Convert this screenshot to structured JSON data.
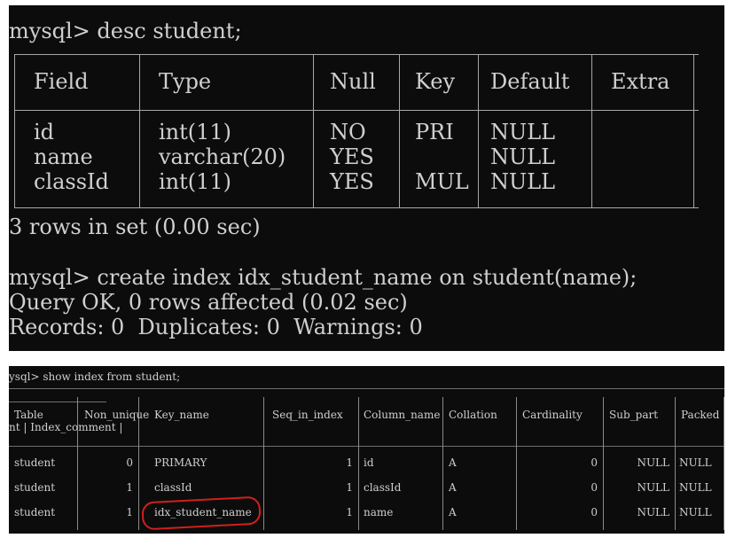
{
  "terminal1": {
    "prompt_cmd": "mysql> desc student;",
    "columns": [
      "Field",
      "Type",
      "Null",
      "Key",
      "Default",
      "Extra"
    ],
    "rows": [
      [
        "id",
        "int(11)",
        "NO",
        "PRI",
        "NULL",
        ""
      ],
      [
        "name",
        "varchar(20)",
        "YES",
        "",
        "NULL",
        ""
      ],
      [
        "classId",
        "int(11)",
        "YES",
        "MUL",
        "NULL",
        ""
      ]
    ],
    "summary": "3 rows in set (0.00 sec)",
    "create_cmd": "mysql> create index idx_student_name on student(name);",
    "result_line1": "Query OK, 0 rows affected (0.02 sec)",
    "result_line2": "Records: 0  Duplicates: 0  Warnings: 0"
  },
  "terminal2": {
    "prompt_cmd": "ysql> show index from student;",
    "header_row1": {
      "Table": "Table",
      "Non_unique": "Non_unique",
      "Key_name": "Key_name",
      "Seq_in_index": "Seq_in_index",
      "Column_name": "Column_name",
      "Collation": "Collation",
      "Cardinality": "Cardinality",
      "Sub_part": "Sub_part",
      "Packed": "Packed"
    },
    "header_row2": "nt | Index_comment |",
    "rows": [
      {
        "table": "student",
        "non_unique": "0",
        "key_name": "PRIMARY",
        "seq": "1",
        "column": "id",
        "collation": "A",
        "cardinality": "0",
        "sub_part": "NULL",
        "packed": "NULL"
      },
      {
        "table": "student",
        "non_unique": "1",
        "key_name": "classId",
        "seq": "1",
        "column": "classId",
        "collation": "A",
        "cardinality": "0",
        "sub_part": "NULL",
        "packed": "NULL"
      },
      {
        "table": "student",
        "non_unique": "1",
        "key_name": "idx_student_name",
        "seq": "1",
        "column": "name",
        "collation": "A",
        "cardinality": "0",
        "sub_part": "NULL",
        "packed": "NULL"
      }
    ],
    "annotation_color": "#d0201c"
  }
}
